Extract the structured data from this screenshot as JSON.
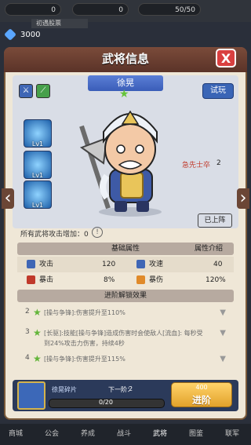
{
  "hud": {
    "slot1": "0",
    "slot2": "0",
    "stamina": "50/50",
    "hint_text": "初遇股票",
    "gems": "3000"
  },
  "panel": {
    "title": "武将信息",
    "close_label": "X"
  },
  "hero": {
    "name": "徐晃",
    "try_label": "试玩",
    "equip_label": "急先士卒",
    "equip_value": "2",
    "stage_btn": "已上阵",
    "skills": [
      {
        "level": "Lv1"
      },
      {
        "level": "Lv1"
      },
      {
        "level": "Lv1"
      }
    ]
  },
  "bonus": {
    "text": "所有武将攻击增加：",
    "value": "0"
  },
  "attributes": {
    "col_basic": "基础属性",
    "col_intro": "属性介绍",
    "rows": [
      {
        "l_label": "攻击",
        "l_value": "120",
        "r_label": "攻速",
        "r_value": "40"
      },
      {
        "l_label": "暴击",
        "l_value": "8%",
        "r_label": "暴伤",
        "r_value": "120%"
      }
    ]
  },
  "advance": {
    "title": "进阶解锁效果",
    "items": [
      {
        "num": "2",
        "text": "[操与争锋]:伤害提升至110%"
      },
      {
        "num": "3",
        "text": "[长驱]:技能[操与争锋]造成伤害时会使敌人[流血]: 每秒受到24%攻击力伤害，持续4秒"
      },
      {
        "num": "4",
        "text": "[操与争锋]:伤害提升至115%"
      }
    ]
  },
  "shard": {
    "name": "徐晃碎片",
    "next_label": "下一阶：",
    "next_value": "2",
    "progress_text": "0/20",
    "progress": 0,
    "cost": "400",
    "advance_btn": "进阶"
  },
  "nav": [
    "商城",
    "公会",
    "养成",
    "战斗",
    "武将",
    "图鉴",
    "联军"
  ]
}
